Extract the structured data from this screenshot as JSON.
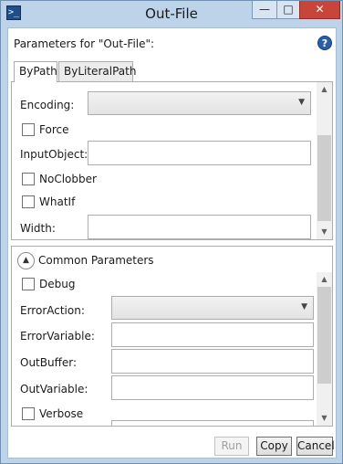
{
  "window": {
    "title": "Out-File",
    "icon": "powershell-icon",
    "caption_buttons": {
      "minimize": "—",
      "maximize": "□",
      "close": "✕"
    }
  },
  "header": {
    "parameters_label": "Parameters for \"Out-File\":",
    "help_icon": "?"
  },
  "tabs": [
    {
      "label": "ByPath",
      "selected": true
    },
    {
      "label": "ByLiteralPath",
      "selected": false
    }
  ],
  "bypath": {
    "encoding_label": "Encoding:",
    "encoding_value": "",
    "force_label": "Force",
    "force_checked": false,
    "inputobject_label": "InputObject:",
    "inputobject_value": "",
    "noclobber_label": "NoClobber",
    "noclobber_checked": false,
    "whatif_label": "WhatIf",
    "whatif_checked": false,
    "width_label": "Width:",
    "width_value": ""
  },
  "common": {
    "title": "Common Parameters",
    "expanded": true,
    "debug_label": "Debug",
    "debug_checked": false,
    "erroraction_label": "ErrorAction:",
    "erroraction_value": "",
    "errorvariable_label": "ErrorVariable:",
    "errorvariable_value": "",
    "outbuffer_label": "OutBuffer:",
    "outbuffer_value": "",
    "outvariable_label": "OutVariable:",
    "outvariable_value": "",
    "verbose_label": "Verbose",
    "verbose_checked": false
  },
  "buttons": {
    "run": "Run",
    "run_enabled": false,
    "copy": "Copy",
    "cancel": "Cancel"
  },
  "colors": {
    "frame": "#bcd3ea",
    "close_button": "#c7453a",
    "help_icon": "#2b5ea8"
  }
}
